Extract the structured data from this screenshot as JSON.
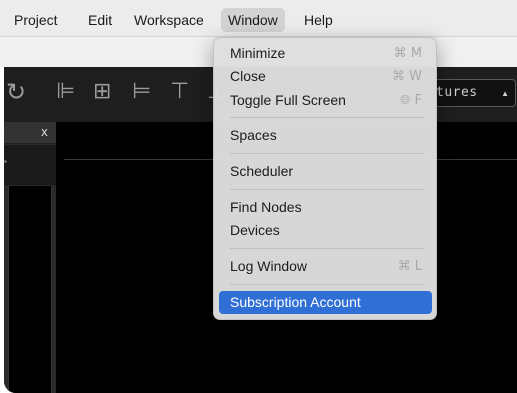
{
  "menubar": {
    "items": [
      {
        "label": "Project"
      },
      {
        "label": "Edit"
      },
      {
        "label": "Workspace"
      },
      {
        "label": "Window"
      },
      {
        "label": "Help"
      }
    ]
  },
  "toolbar": {
    "icons": [
      "refresh-icon",
      "align-left-icon",
      "align-center-icon",
      "align-right-icon",
      "align-top-icon",
      "align-middle-icon"
    ],
    "features_select": {
      "value": "tures"
    }
  },
  "left_panel": {
    "close_label": "x"
  },
  "window_menu": {
    "items": [
      {
        "label": "Minimize",
        "shortcut": "⌘ M"
      },
      {
        "label": "Close",
        "shortcut": "⌘ W"
      },
      {
        "label": "Toggle Full Screen",
        "shortcut": "🌐︎ F"
      },
      {
        "label": "Spaces"
      },
      {
        "label": "Scheduler"
      },
      {
        "label": "Find Nodes"
      },
      {
        "label": "Devices"
      },
      {
        "label": "Log Window",
        "shortcut": "⌘ L"
      },
      {
        "label": "Subscription Account"
      }
    ]
  },
  "colors": {
    "selection": "#2f6fd6",
    "menu_background": "#dedede",
    "app_background": "#000000"
  }
}
